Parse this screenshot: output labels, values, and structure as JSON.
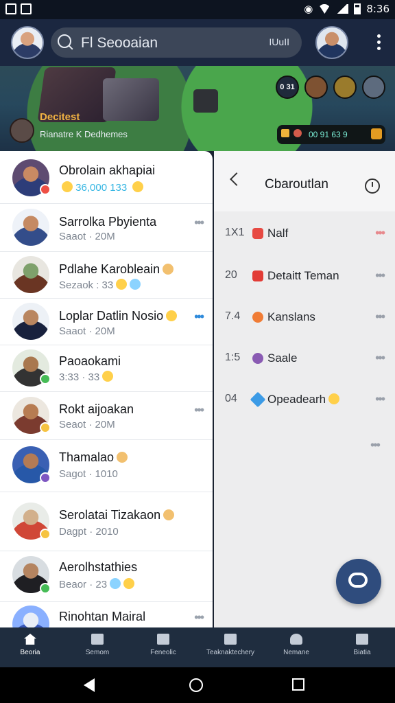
{
  "status": {
    "time": "8:36"
  },
  "header": {
    "search_placeholder": "Fl Seooaian",
    "search_badge": "IUuII"
  },
  "game": {
    "title": "Decitest",
    "subtitle": "Rianatre K Dedhemes",
    "top_badges": [
      "0 31",
      "",
      "",
      ""
    ],
    "resource_value": "00 91 63 9"
  },
  "chats": [
    {
      "name": "Obrolain akhapiai",
      "subtitle": "36,000 133"
    },
    {
      "name": "Sarrolka Pbyienta",
      "subtitle": "Saaot · 20M"
    },
    {
      "name": "Pdlahe Karobleain",
      "subtitle": "Sezaok : 33"
    },
    {
      "name": "Loplar Datlin Nosio",
      "subtitle": "Saaot · 20M"
    },
    {
      "name": "Paoaokami",
      "subtitle": "3:33 · 33"
    },
    {
      "name": "Rokt aijoakan",
      "subtitle": "Seaot · 20M"
    },
    {
      "name": "Thamalao",
      "subtitle": "Sagot · 1010"
    },
    {
      "name": "Serolatai Tizakaon",
      "subtitle": "Dagpt · 2010"
    },
    {
      "name": "Aerolhstathies",
      "subtitle": "Beaor · 23"
    },
    {
      "name": "Rinohtan Mairal",
      "subtitle": ""
    }
  ],
  "right_panel": {
    "title": "Cbaroutlan",
    "options": [
      {
        "num": "1X1",
        "label": "Nalf",
        "icon_color": "#e74a43"
      },
      {
        "num": "20",
        "label": "Detaitt Teman",
        "icon_color": "#e23c36"
      },
      {
        "num": "7.4",
        "label": "Kanslans",
        "icon_color": "#f07c35"
      },
      {
        "num": "1:5",
        "label": "Saale",
        "icon_color": "#8a5bb3"
      },
      {
        "num": "04",
        "label": "Opeadearh",
        "icon_color": "#3c9be6"
      }
    ]
  },
  "bottom_nav": [
    {
      "label": "Beoria"
    },
    {
      "label": "Semom"
    },
    {
      "label": "Feneolic"
    },
    {
      "label": "Teaknaktechery"
    },
    {
      "label": "Nemane"
    },
    {
      "label": "Biatia"
    }
  ],
  "colors": {
    "header_bg": "#1b2740",
    "nav_bg": "#1f2d3f",
    "fab_bg": "#2f4c7d",
    "game_gold": "#f2b342"
  }
}
